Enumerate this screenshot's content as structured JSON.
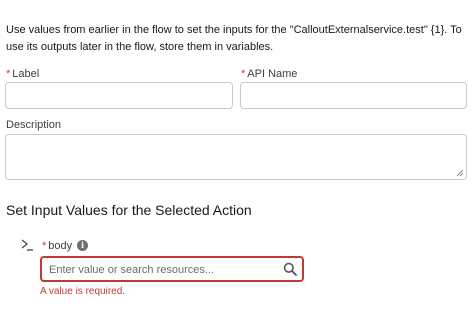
{
  "intro_text": "Use values from earlier in the flow to set the inputs for the \"CalloutExternalservice.test\" {1}. To use its outputs later in the flow, store them in variables.",
  "fields": {
    "label": {
      "required_mark": "*",
      "label": "Label",
      "value": ""
    },
    "api_name": {
      "required_mark": "*",
      "label": "API Name",
      "value": ""
    },
    "description": {
      "label": "Description",
      "value": ""
    }
  },
  "section_title": "Set Input Values for the Selected Action",
  "input_param": {
    "required_mark": "*",
    "name": "body",
    "info_glyph": "i",
    "placeholder": "Enter value or search resources...",
    "value": "",
    "error": "A value is required.",
    "icons": [
      "chevron-right-icon",
      "info-icon",
      "search-icon"
    ]
  },
  "colors": {
    "error": "#c23934",
    "border": "#c9c9c9",
    "text": "#181818"
  }
}
